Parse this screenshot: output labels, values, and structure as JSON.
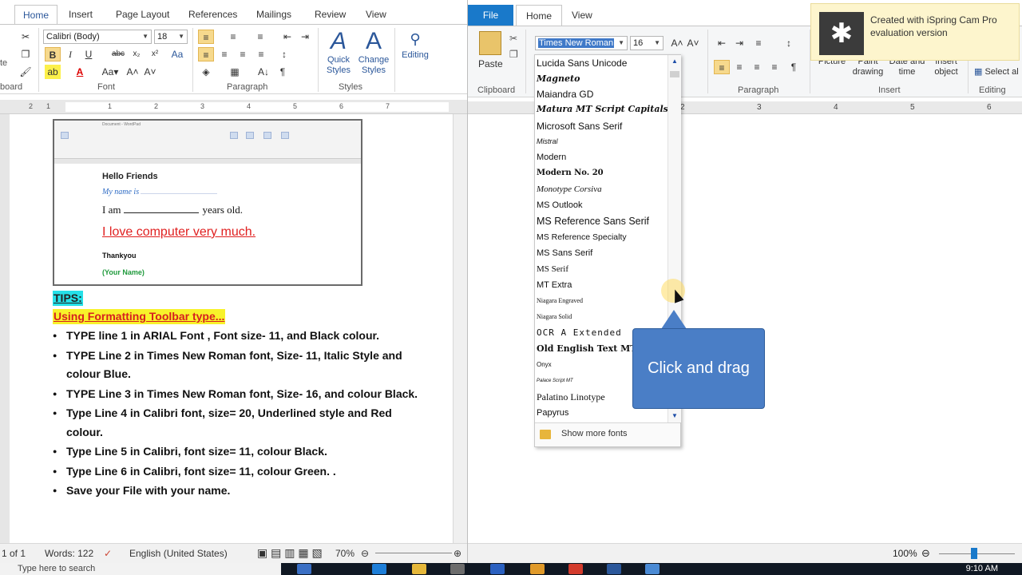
{
  "word": {
    "tabs": [
      "Home",
      "Insert",
      "Page Layout",
      "References",
      "Mailings",
      "Review",
      "View"
    ],
    "font_name": "Calibri (Body)",
    "font_size": "18",
    "groups": {
      "clipboard": "board",
      "font": "Font",
      "paragraph": "Paragraph",
      "styles": "Styles"
    },
    "quick_styles": "Quick Styles",
    "change_styles": "Change Styles",
    "editing": "Editing",
    "paste_fragment": "te",
    "ruler_numbers": [
      "2",
      "1",
      "1",
      "2",
      "3",
      "4",
      "5",
      "6",
      "7"
    ],
    "embedded": {
      "title": "Document - WordPad",
      "hello": "Hello Friends",
      "myname": "My name is",
      "age_prefix": "I am",
      "age_suffix": "years old.",
      "love": "I love computer very much.",
      "thanks": "Thankyou",
      "yourname": "(Your Name)"
    },
    "tips": "TIPS:",
    "using": "Using Formatting Toolbar type...",
    "bullets": [
      "TYPE line 1 in ARIAL Font , Font size- 11, and Black colour.",
      "TYPE Line 2 in Times  New Roman font, Size- 11, Italic Style and colour Blue.",
      "TYPE Line 3 in Times  New Roman font, Size- 16, and colour Black.",
      "Type Line 4 in Calibri font, size= 20, Underlined style and Red colour.",
      "Type Line 5 in Calibri, font size= 11, colour Black.",
      "Type Line 6 in Calibri, font size= 11, colour Green. .",
      "Save your File with your name."
    ],
    "status": {
      "page": "1 of 1",
      "words": "Words: 122",
      "language": "English (United States)",
      "zoom": "70%"
    }
  },
  "wordpad": {
    "file_tab": "File",
    "tabs": [
      "Home",
      "View"
    ],
    "font_name": "Times New Roman",
    "font_size": "16",
    "paste": "Paste",
    "clipboard": "Clipboard",
    "paragraph": "Paragraph",
    "insert": "Insert",
    "editing": "Editing",
    "picture": "Picture",
    "paint": "Paint drawing",
    "datetime": "Date and time",
    "insert_object": "Insert object",
    "select_all": "Select al",
    "ruler_numbers": [
      "2",
      "3",
      "4",
      "5",
      "6"
    ],
    "zoom": "100%"
  },
  "font_dropdown": {
    "items": [
      "Lucida Sans Unicode",
      "Magneto",
      "Maiandra GD",
      "Matura MT Script Capitals",
      "Microsoft Sans Serif",
      "Mistral",
      "Modern",
      "Modern No. 20",
      "Monotype Corsiva",
      "MS Outlook",
      "MS Reference Sans Serif",
      "MS Reference Specialty",
      "MS Sans Serif",
      "MS Serif",
      "MT Extra",
      "Niagara Engraved",
      "Niagara Solid",
      "OCR A Extended",
      "Old English Text MT",
      "Onyx",
      "Palace Script MT",
      "Palatino Linotype",
      "Papyrus"
    ],
    "show_more": "Show more fonts"
  },
  "notification": {
    "text": "Created with iSpring Cam Pro evaluation version"
  },
  "callout": {
    "text": "Click and drag"
  },
  "taskbar": {
    "search": "Type here to search",
    "time": "9:10 AM"
  },
  "colors": {
    "word_blue": "#2b579a",
    "wordpad_file": "#1979ca",
    "callout": "#4a7ec6",
    "tips_bg": "#25e0e8",
    "using_bg": "#f8f22a"
  }
}
